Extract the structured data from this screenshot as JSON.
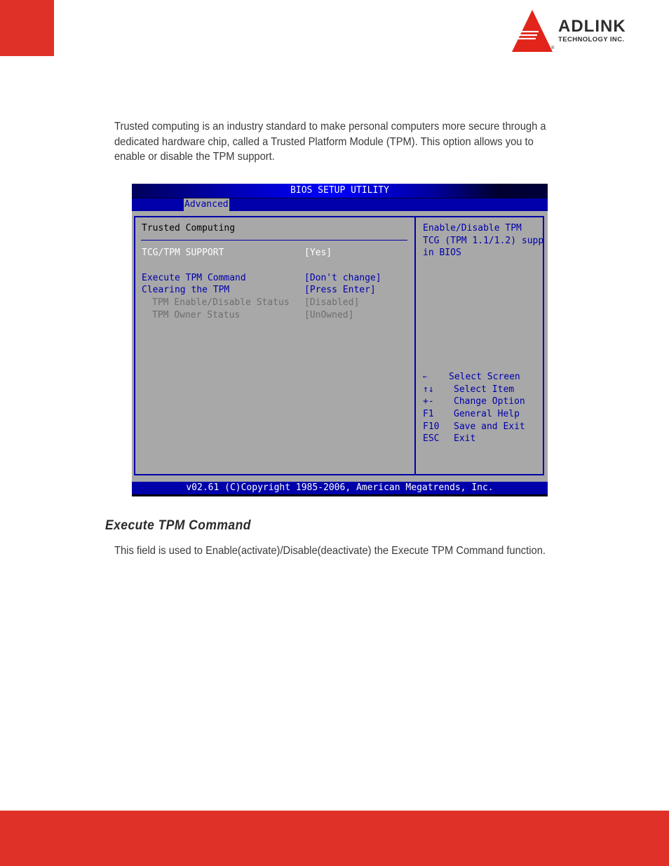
{
  "brand": {
    "name": "ADLINK",
    "tagline": "TECHNOLOGY INC.",
    "registered": "®",
    "accent_color": "#df3127"
  },
  "intro_text": "Trusted computing is an industry standard to make personal computers more secure through a dedicated hardware chip, called a Trusted Platform Module (TPM). This option allows you to enable or disable the TPM support.",
  "bios": {
    "title": "BIOS SETUP UTILITY",
    "active_tab": "Advanced",
    "section_heading": "Trusted Computing",
    "settings": [
      {
        "label": "TCG/TPM SUPPORT",
        "value": "[Yes]",
        "state": "selected"
      },
      {
        "label": "Execute TPM Command",
        "value": "[Don't change]",
        "state": "editable"
      },
      {
        "label": "Clearing the TPM",
        "value": "[Press Enter]",
        "state": "editable"
      },
      {
        "label": "TPM Enable/Disable Status",
        "value": "[Disabled]",
        "state": "readonly"
      },
      {
        "label": "TPM Owner Status",
        "value": "[UnOwned]",
        "state": "readonly"
      }
    ],
    "help_text": [
      "Enable/Disable TPM",
      "TCG (TPM 1.1/1.2) supp",
      "in BIOS"
    ],
    "key_legend": [
      {
        "key": "←",
        "action": "Select Screen"
      },
      {
        "key": "↑↓",
        "action": "Select Item"
      },
      {
        "key": "+-",
        "action": "Change Option"
      },
      {
        "key": "F1",
        "action": "General Help"
      },
      {
        "key": "F10",
        "action": "Save and Exit"
      },
      {
        "key": "ESC",
        "action": "Exit"
      }
    ],
    "status_bar": "v02.61 (C)Copyright 1985-2006, American Megatrends, Inc."
  },
  "section": {
    "title": "Execute TPM Command",
    "description": "This field is used to Enable(activate)/Disable(deactivate) the Execute TPM Command function."
  }
}
